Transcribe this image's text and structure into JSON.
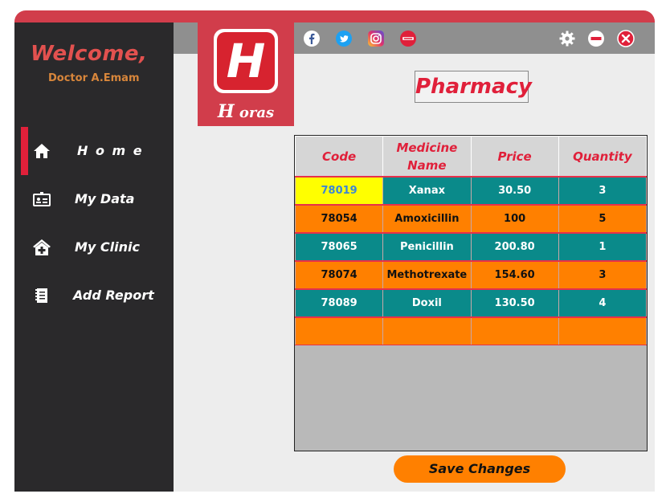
{
  "sidebar": {
    "welcome": "Welcome,",
    "doctor": "Doctor A.Emam",
    "items": [
      {
        "label": "H o m e",
        "icon": "home-icon",
        "active": true
      },
      {
        "label": "My Data",
        "icon": "id-card-icon"
      },
      {
        "label": "My Clinic",
        "icon": "clinic-icon"
      },
      {
        "label": "Add Report",
        "icon": "report-icon"
      }
    ]
  },
  "logo": {
    "letter": "H",
    "brand_first": "H",
    "brand_rest": " oras"
  },
  "social": [
    "facebook-icon",
    "twitter-icon",
    "instagram-icon",
    "askfm-icon"
  ],
  "window_controls": [
    "settings-icon",
    "minimize-icon",
    "close-icon"
  ],
  "page": {
    "title": "Pharmacy"
  },
  "table": {
    "headers": [
      "Code",
      "Medicine Name",
      "Price",
      "Quantity"
    ],
    "rows": [
      [
        "78019",
        "Xanax",
        "30.50",
        "3"
      ],
      [
        "78054",
        "Amoxicillin",
        "100",
        "5"
      ],
      [
        "78065",
        "Penicillin",
        "200.80",
        "1"
      ],
      [
        "78074",
        "Methotrexate",
        "154.60",
        "3"
      ],
      [
        "78089",
        "Doxil",
        "130.50",
        "4"
      ],
      [
        "",
        "",
        "",
        ""
      ]
    ]
  },
  "save_label": "Save Changes",
  "colors": {
    "accent": "#d13d4b",
    "teal": "#0a8a8a",
    "orange": "#ff8000",
    "sidebar": "#2a292b"
  }
}
